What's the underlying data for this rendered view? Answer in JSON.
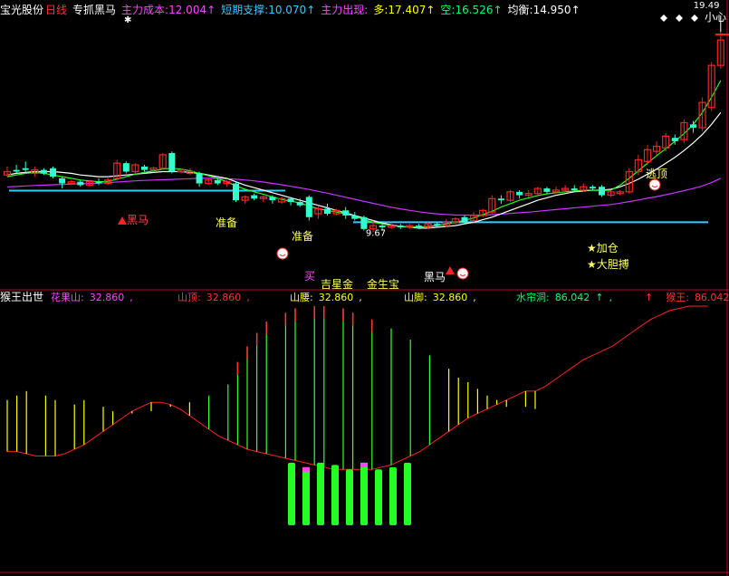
{
  "top_header": {
    "stock": "宝光股份",
    "period": "日线",
    "indicator": "专抓黑马",
    "items": [
      {
        "label": "主力成本:",
        "value": "12.004",
        "arrow": "↑",
        "color": "#ff44ff"
      },
      {
        "label": "短期支撑:",
        "value": "10.070",
        "arrow": "↑",
        "color": "#33ccff"
      },
      {
        "label": "主力出现:",
        "value": "",
        "arrow": "",
        "color": "#ff44ff"
      },
      {
        "label": "多:",
        "value": "17.407",
        "arrow": "↑",
        "color": "#ffff00"
      },
      {
        "label": "空:",
        "value": "16.526",
        "arrow": "↑",
        "color": "#00ff66"
      },
      {
        "label": "均衡:",
        "value": "14.950",
        "arrow": "↑",
        "color": "#ffffff"
      }
    ],
    "caution": "小心"
  },
  "bottom_header": {
    "title": "猴王出世",
    "items": [
      {
        "label": "花果山:",
        "value": "32.860",
        "color": "#ff44ff"
      },
      {
        "label": "山顶:",
        "value": "32.860",
        "color": "#ff3333"
      },
      {
        "label": "山腰:",
        "value": "32.860",
        "color": "#ffff00"
      },
      {
        "label": "山脚:",
        "value": "32.860",
        "color": "#ffff00"
      },
      {
        "label": "水帘洞:",
        "value": "86.042",
        "arrow": "↑",
        "color": "#00ff66"
      },
      {
        "label": "猴王:",
        "value": "86.042",
        "arrow": "↑",
        "color": "#ff3333",
        "prefix": "↑"
      }
    ]
  },
  "chart_data": [
    {
      "type": "candlestick",
      "price_range": [
        4.3,
        20.3
      ],
      "annotation_max_price": "19.49",
      "annotation_min_price": "9.67",
      "support_lines": [
        10.07,
        8.2
      ],
      "candles": [
        {
          "o": 11.0,
          "c": 11.2,
          "h": 11.5,
          "l": 10.9
        },
        {
          "o": 11.3,
          "c": 11.2,
          "h": 11.6,
          "l": 11.1
        },
        {
          "o": 11.4,
          "c": 11.3,
          "h": 11.8,
          "l": 11.2
        },
        {
          "o": 11.1,
          "c": 11.3,
          "h": 11.5,
          "l": 10.9
        },
        {
          "o": 11.3,
          "c": 11.1,
          "h": 11.4,
          "l": 11.0
        },
        {
          "o": 11.4,
          "c": 10.9,
          "h": 11.5,
          "l": 10.8
        },
        {
          "o": 10.8,
          "c": 10.5,
          "h": 10.9,
          "l": 10.2
        },
        {
          "o": 10.5,
          "c": 10.6,
          "h": 10.7,
          "l": 10.4
        },
        {
          "o": 10.6,
          "c": 10.4,
          "h": 10.7,
          "l": 10.3
        },
        {
          "o": 10.4,
          "c": 10.6,
          "h": 10.7,
          "l": 10.3
        },
        {
          "o": 10.6,
          "c": 10.5,
          "h": 10.8,
          "l": 10.4
        },
        {
          "o": 10.5,
          "c": 10.7,
          "h": 10.9,
          "l": 10.4
        },
        {
          "o": 10.8,
          "c": 11.7,
          "h": 11.9,
          "l": 10.7
        },
        {
          "o": 11.7,
          "c": 11.2,
          "h": 11.8,
          "l": 11.1
        },
        {
          "o": 11.2,
          "c": 11.6,
          "h": 11.7,
          "l": 11.1
        },
        {
          "o": 11.5,
          "c": 11.3,
          "h": 11.6,
          "l": 11.2
        },
        {
          "o": 11.3,
          "c": 11.4,
          "h": 11.5,
          "l": 11.2
        },
        {
          "o": 11.4,
          "c": 12.2,
          "h": 12.3,
          "l": 11.3
        },
        {
          "o": 12.3,
          "c": 11.2,
          "h": 12.4,
          "l": 11.1
        },
        {
          "o": 11.2,
          "c": 11.3,
          "h": 11.4,
          "l": 11.1
        },
        {
          "o": 11.1,
          "c": 11.2,
          "h": 11.4,
          "l": 11.0
        },
        {
          "o": 11.1,
          "c": 10.5,
          "h": 11.2,
          "l": 10.3
        },
        {
          "o": 10.5,
          "c": 10.7,
          "h": 10.8,
          "l": 10.4
        },
        {
          "o": 10.7,
          "c": 10.5,
          "h": 10.8,
          "l": 10.4
        },
        {
          "o": 10.5,
          "c": 10.6,
          "h": 10.7,
          "l": 10.3
        },
        {
          "o": 10.5,
          "c": 9.5,
          "h": 10.6,
          "l": 9.4
        },
        {
          "o": 9.5,
          "c": 9.7,
          "h": 9.8,
          "l": 9.3
        },
        {
          "o": 9.8,
          "c": 9.6,
          "h": 9.9,
          "l": 9.5
        },
        {
          "o": 9.6,
          "c": 9.7,
          "h": 9.8,
          "l": 9.4
        },
        {
          "o": 9.7,
          "c": 9.5,
          "h": 9.8,
          "l": 9.3
        },
        {
          "o": 9.4,
          "c": 9.6,
          "h": 9.7,
          "l": 9.3
        },
        {
          "o": 9.6,
          "c": 9.4,
          "h": 9.7,
          "l": 9.2
        },
        {
          "o": 9.4,
          "c": 9.2,
          "h": 9.6,
          "l": 9.1
        },
        {
          "o": 9.7,
          "c": 8.5,
          "h": 9.8,
          "l": 8.3
        },
        {
          "o": 8.7,
          "c": 9.0,
          "h": 9.2,
          "l": 8.4
        },
        {
          "o": 9.0,
          "c": 8.7,
          "h": 9.3,
          "l": 8.6
        },
        {
          "o": 8.7,
          "c": 8.9,
          "h": 9.0,
          "l": 8.6
        },
        {
          "o": 8.9,
          "c": 8.6,
          "h": 9.1,
          "l": 8.4
        },
        {
          "o": 8.6,
          "c": 8.4,
          "h": 8.8,
          "l": 8.3
        },
        {
          "o": 8.5,
          "c": 7.8,
          "h": 8.6,
          "l": 7.7
        },
        {
          "o": 7.8,
          "c": 8.0,
          "h": 8.3,
          "l": 7.6
        },
        {
          "o": 8.0,
          "c": 7.9,
          "h": 8.1,
          "l": 7.7
        },
        {
          "o": 7.9,
          "c": 8.0,
          "h": 8.1,
          "l": 7.8
        },
        {
          "o": 8.0,
          "c": 7.9,
          "h": 8.1,
          "l": 7.8
        },
        {
          "o": 7.9,
          "c": 8.0,
          "h": 8.1,
          "l": 7.8
        },
        {
          "o": 8.0,
          "c": 7.9,
          "h": 8.1,
          "l": 7.8
        },
        {
          "o": 7.9,
          "c": 8.1,
          "h": 8.2,
          "l": 7.8
        },
        {
          "o": 8.1,
          "c": 8.0,
          "h": 8.2,
          "l": 7.9
        },
        {
          "o": 8.0,
          "c": 8.2,
          "h": 8.4,
          "l": 7.9
        },
        {
          "o": 8.2,
          "c": 8.4,
          "h": 8.5,
          "l": 8.1
        },
        {
          "o": 8.5,
          "c": 8.2,
          "h": 8.6,
          "l": 8.1
        },
        {
          "o": 8.3,
          "c": 8.6,
          "h": 8.8,
          "l": 8.2
        },
        {
          "o": 8.6,
          "c": 8.9,
          "h": 9.0,
          "l": 8.5
        },
        {
          "o": 8.8,
          "c": 9.6,
          "h": 9.8,
          "l": 8.7
        },
        {
          "o": 9.6,
          "c": 9.5,
          "h": 9.8,
          "l": 9.3
        },
        {
          "o": 9.5,
          "c": 10.0,
          "h": 10.1,
          "l": 9.4
        },
        {
          "o": 10.0,
          "c": 9.8,
          "h": 10.1,
          "l": 9.6
        },
        {
          "o": 9.8,
          "c": 9.9,
          "h": 10.1,
          "l": 9.7
        },
        {
          "o": 9.9,
          "c": 10.2,
          "h": 10.3,
          "l": 9.8
        },
        {
          "o": 10.2,
          "c": 10.0,
          "h": 10.3,
          "l": 9.9
        },
        {
          "o": 10.0,
          "c": 10.1,
          "h": 10.3,
          "l": 9.9
        },
        {
          "o": 10.1,
          "c": 10.2,
          "h": 10.4,
          "l": 10.0
        },
        {
          "o": 10.2,
          "c": 10.1,
          "h": 10.4,
          "l": 10.0
        },
        {
          "o": 10.1,
          "c": 10.3,
          "h": 10.5,
          "l": 10.0
        },
        {
          "o": 10.3,
          "c": 10.2,
          "h": 10.4,
          "l": 10.1
        },
        {
          "o": 10.3,
          "c": 9.8,
          "h": 10.4,
          "l": 9.7
        },
        {
          "o": 9.8,
          "c": 10.0,
          "h": 10.1,
          "l": 9.7
        },
        {
          "o": 9.9,
          "c": 10.0,
          "h": 10.1,
          "l": 9.8
        },
        {
          "o": 10.0,
          "c": 11.2,
          "h": 11.4,
          "l": 9.9
        },
        {
          "o": 11.2,
          "c": 11.9,
          "h": 12.2,
          "l": 11.0
        },
        {
          "o": 11.8,
          "c": 12.5,
          "h": 12.8,
          "l": 11.6
        },
        {
          "o": 12.4,
          "c": 12.7,
          "h": 13.0,
          "l": 12.2
        },
        {
          "o": 12.6,
          "c": 13.3,
          "h": 13.5,
          "l": 12.4
        },
        {
          "o": 13.2,
          "c": 13.0,
          "h": 13.4,
          "l": 12.8
        },
        {
          "o": 13.1,
          "c": 14.1,
          "h": 14.3,
          "l": 12.9
        },
        {
          "o": 14.0,
          "c": 13.8,
          "h": 14.2,
          "l": 13.5
        },
        {
          "o": 13.8,
          "c": 15.3,
          "h": 15.6,
          "l": 13.6
        },
        {
          "o": 15.0,
          "c": 17.5,
          "h": 17.7,
          "l": 14.8
        },
        {
          "o": 17.5,
          "c": 19.0,
          "h": 19.49,
          "l": 17.3
        }
      ],
      "ma_white": [
        11.0,
        11.1,
        11.15,
        11.2,
        11.2,
        11.2,
        11.15,
        11.1,
        11.0,
        10.95,
        10.9,
        10.9,
        10.95,
        11.0,
        11.05,
        11.1,
        11.15,
        11.2,
        11.2,
        11.2,
        11.15,
        11.1,
        11.0,
        10.9,
        10.8,
        10.6,
        10.4,
        10.25,
        10.1,
        9.95,
        9.8,
        9.65,
        9.5,
        9.35,
        9.2,
        9.05,
        8.9,
        8.75,
        8.6,
        8.45,
        8.3,
        8.15,
        8.05,
        7.95,
        7.9,
        7.85,
        7.85,
        7.9,
        7.95,
        8.0,
        8.1,
        8.2,
        8.35,
        8.5,
        8.7,
        8.9,
        9.1,
        9.3,
        9.5,
        9.65,
        9.8,
        9.9,
        10.0,
        10.05,
        10.1,
        10.1,
        10.15,
        10.3,
        10.5,
        10.75,
        11.05,
        11.35,
        11.7,
        12.05,
        12.45,
        12.9,
        13.4,
        14.0,
        14.7
      ],
      "ma_magenta": [
        10.3,
        10.32,
        10.35,
        10.38,
        10.4,
        10.42,
        10.44,
        10.46,
        10.48,
        10.5,
        10.52,
        10.55,
        10.58,
        10.62,
        10.65,
        10.68,
        10.7,
        10.72,
        10.74,
        10.76,
        10.78,
        10.8,
        10.8,
        10.8,
        10.78,
        10.75,
        10.7,
        10.65,
        10.58,
        10.5,
        10.42,
        10.33,
        10.24,
        10.14,
        10.03,
        9.92,
        9.8,
        9.68,
        9.56,
        9.44,
        9.32,
        9.2,
        9.09,
        8.99,
        8.9,
        8.82,
        8.75,
        8.7,
        8.66,
        8.63,
        8.62,
        8.62,
        8.63,
        8.65,
        8.68,
        8.72,
        8.76,
        8.8,
        8.85,
        8.9,
        8.95,
        9.0,
        9.05,
        9.1,
        9.15,
        9.2,
        9.25,
        9.33,
        9.42,
        9.52,
        9.62,
        9.72,
        9.83,
        9.95,
        10.07,
        10.2,
        10.35,
        10.55,
        10.8
      ],
      "ma_green": [
        10.9,
        11.0,
        11.1,
        11.15,
        11.1,
        11.0,
        10.9,
        10.8,
        10.7,
        10.65,
        10.6,
        10.62,
        10.75,
        10.9,
        11.05,
        11.15,
        11.25,
        11.35,
        11.4,
        11.35,
        11.25,
        11.1,
        10.95,
        10.8,
        10.6,
        10.35,
        10.15,
        10.0,
        9.85,
        9.7,
        9.55,
        9.45,
        9.35,
        9.15,
        9.0,
        8.9,
        8.8,
        8.7,
        8.55,
        8.35,
        8.2,
        8.1,
        8.0,
        7.95,
        7.92,
        7.92,
        7.95,
        8.0,
        8.1,
        8.2,
        8.32,
        8.45,
        8.65,
        8.85,
        9.1,
        9.3,
        9.5,
        9.65,
        9.78,
        9.88,
        9.95,
        10.0,
        10.05,
        10.1,
        10.1,
        10.08,
        10.1,
        10.4,
        10.8,
        11.25,
        11.7,
        12.15,
        12.55,
        13.0,
        13.45,
        14.0,
        14.7,
        15.6,
        16.6
      ]
    },
    {
      "type": "bar",
      "title": "猴王出世",
      "value_range": [
        0,
        100
      ],
      "red_curve": [
        35,
        35,
        34,
        33,
        33,
        33,
        34,
        36,
        38,
        41,
        44,
        47,
        50,
        53,
        55,
        57,
        57,
        56,
        54,
        51,
        48,
        45,
        42,
        40,
        38,
        36,
        35,
        34,
        33,
        32,
        31,
        30,
        29,
        28,
        27,
        27,
        27,
        27,
        27,
        28,
        29,
        31,
        33,
        35,
        38,
        41,
        44,
        47,
        50,
        52,
        54,
        56,
        58,
        60,
        62,
        62,
        64,
        67,
        70,
        73,
        76,
        78,
        80,
        82,
        85,
        88,
        91,
        94,
        96,
        98,
        99,
        100,
        100,
        100
      ],
      "yellow_bars": [
        [
          0,
          58
        ],
        [
          1,
          60
        ],
        [
          2,
          62
        ],
        [
          4,
          60
        ],
        [
          5,
          58
        ],
        [
          7,
          56
        ],
        [
          8,
          58
        ],
        [
          10,
          55
        ],
        [
          11,
          53
        ],
        [
          13,
          52
        ],
        [
          15,
          53
        ],
        [
          17,
          55
        ],
        [
          19,
          57
        ],
        [
          21,
          60
        ],
        [
          23,
          65
        ],
        [
          24,
          75
        ],
        [
          25,
          82
        ],
        [
          26,
          88
        ],
        [
          27,
          93
        ],
        [
          29,
          97
        ],
        [
          30,
          99
        ],
        [
          32,
          100
        ],
        [
          33,
          100
        ],
        [
          35,
          99
        ],
        [
          36,
          97
        ],
        [
          38,
          94
        ],
        [
          40,
          90
        ],
        [
          42,
          85
        ],
        [
          44,
          78
        ],
        [
          46,
          72
        ],
        [
          47,
          68
        ],
        [
          48,
          66
        ],
        [
          49,
          63
        ],
        [
          50,
          60
        ],
        [
          51,
          58
        ],
        [
          52,
          55
        ],
        [
          54,
          55
        ],
        [
          55,
          54
        ]
      ],
      "magenta_bar_tops": [
        24,
        25,
        26,
        27,
        29,
        30,
        32,
        33,
        35,
        36,
        38
      ],
      "green_bars": [
        [
          24,
          30
        ],
        [
          25,
          28
        ],
        [
          26,
          30
        ],
        [
          27,
          29
        ],
        [
          28,
          27
        ],
        [
          29,
          30
        ],
        [
          30,
          27
        ],
        [
          31,
          28
        ],
        [
          32,
          30
        ]
      ],
      "green_bar_tops_magenta": [
        25,
        29
      ]
    }
  ],
  "overlay_labels": {
    "dark_horse_1": "黑马",
    "prepare_1": "准备",
    "prepare_2": "准备",
    "buy": "买",
    "auspicious": "吉星金",
    "shiner": "金生宝",
    "dark_horse_2": "黑马",
    "add_position": "★加仓",
    "bold_buy": "★大胆搏",
    "escape_top": "逃顶"
  }
}
